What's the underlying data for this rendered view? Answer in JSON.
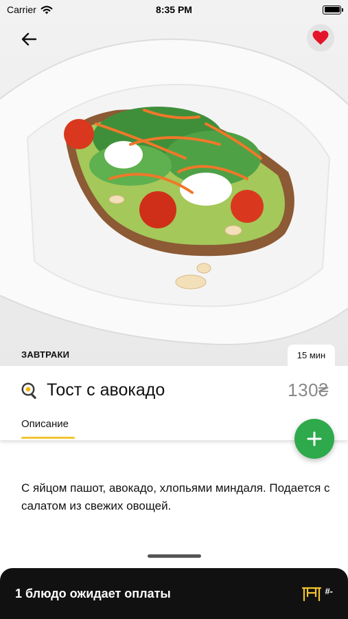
{
  "status_bar": {
    "carrier": "Carrier",
    "time": "8:35 PM"
  },
  "header": {
    "back_icon": "arrow-left-icon",
    "favorite_icon": "heart-icon",
    "favorite_color": "#e4152b"
  },
  "dish": {
    "category": "ЗАВТРАКИ",
    "cook_time": "15 мин",
    "icon": "frying-pan-egg-icon",
    "title": "Тост с авокадо",
    "price": "130₴",
    "tab_label": "Описание",
    "description": "С яйцом пашот, авокадо, хлопьями миндаля. Подается с салатом из свежих овощей."
  },
  "add_button": {
    "icon": "plus-icon",
    "color": "#2ea94b"
  },
  "bottom_bar": {
    "message": "1 блюдо ожидает оплаты",
    "table_icon": "table-icon",
    "table_number": "#-",
    "accent": "#f4c430"
  }
}
